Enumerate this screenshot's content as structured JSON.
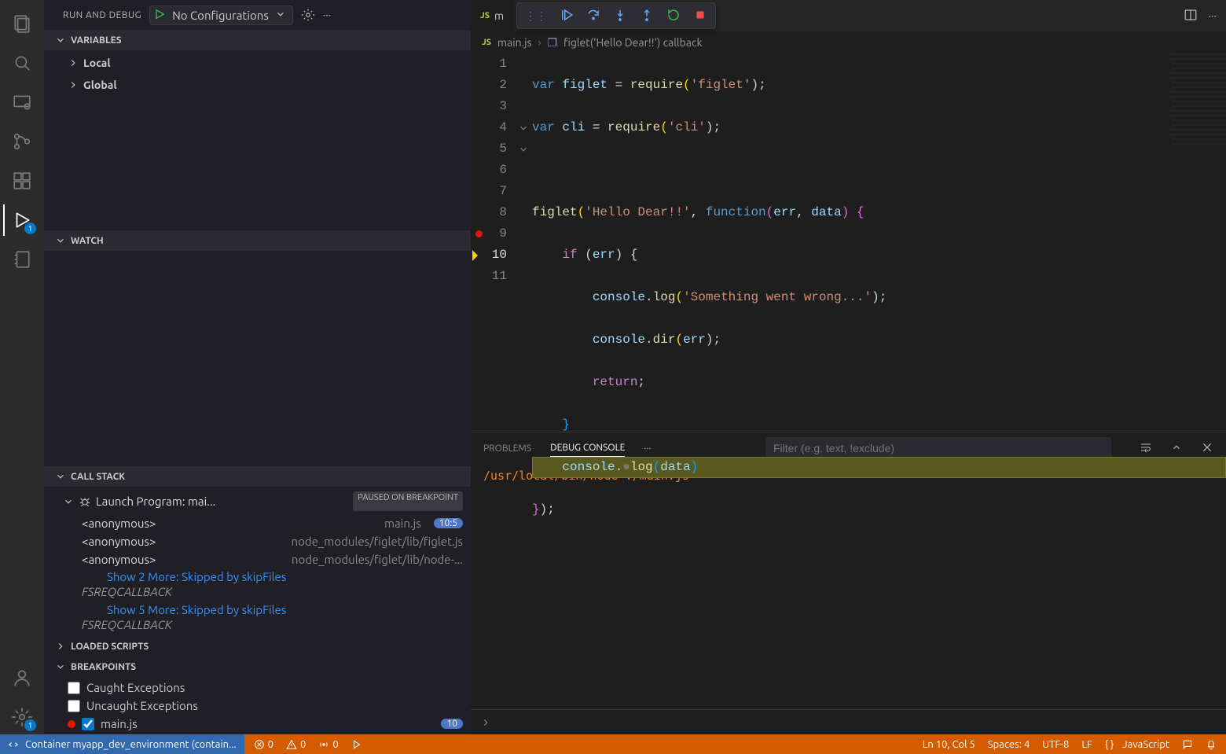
{
  "sidebar": {
    "title": "RUN AND DEBUG",
    "config": "No Configurations",
    "sections": {
      "variables": {
        "label": "VARIABLES",
        "scopes": [
          "Local",
          "Global"
        ]
      },
      "watch": {
        "label": "WATCH"
      },
      "callstack": {
        "label": "CALL STACK",
        "thread": "Launch Program: mai...",
        "status": "PAUSED ON BREAKPOINT",
        "frames": [
          {
            "fn": "<anonymous>",
            "src": "main.js",
            "pos": "10:5"
          },
          {
            "fn": "<anonymous>",
            "src": "node_modules/figlet/lib/figlet.js"
          },
          {
            "fn": "<anonymous>",
            "src": "node_modules/figlet/lib/node-..."
          }
        ],
        "skip1": "Show 2 More: Skipped by skipFiles",
        "origin1": "FSREQCALLBACK",
        "skip2": "Show 5 More: Skipped by skipFiles",
        "origin2": "FSREQCALLBACK"
      },
      "loaded": {
        "label": "LOADED SCRIPTS"
      },
      "breakpoints": {
        "label": "BREAKPOINTS",
        "caught": "Caught Exceptions",
        "uncaught": "Uncaught Exceptions",
        "file": "main.js",
        "line": "10"
      }
    }
  },
  "activity": {
    "debug_badge": "1",
    "settings_badge": "1"
  },
  "editor": {
    "tab_name": "m",
    "breadcrumb_file": "main.js",
    "breadcrumb_symbol": "figlet('Hello Dear!!') callback",
    "current_line": 10,
    "lines": [
      "1",
      "2",
      "3",
      "4",
      "5",
      "6",
      "7",
      "8",
      "9",
      "10",
      "11"
    ],
    "code": {
      "l1": {
        "a": "var ",
        "b": "figlet",
        "c": " = ",
        "d": "require",
        "e": "(",
        "f": "'figlet'",
        "g": ");"
      },
      "l2": {
        "a": "var ",
        "b": "cli",
        "c": " = ",
        "d": "require",
        "e": "(",
        "f": "'cli'",
        "g": ");"
      },
      "l3": "",
      "l4": {
        "a": "figlet",
        "b": "(",
        "c": "'Hello Dear!!'",
        "d": ", ",
        "e": "function",
        "f": "(",
        "g": "err",
        "h": ", ",
        "i": "data",
        "j": ") ",
        "k": "{"
      },
      "l5": {
        "a": "    ",
        "b": "if",
        "c": " (",
        "d": "err",
        "e": ") {"
      },
      "l6": {
        "a": "        ",
        "b": "console",
        "c": ".",
        "d": "log",
        "e": "(",
        "f": "'Something went wrong...'",
        "g": ");"
      },
      "l7": {
        "a": "        ",
        "b": "console",
        "c": ".",
        "d": "dir",
        "e": "(",
        "f": "err",
        "g": ");"
      },
      "l8": {
        "a": "        ",
        "b": "return",
        "c": ";"
      },
      "l9": {
        "a": "    ",
        "b": "}"
      },
      "l10": {
        "a": "    ",
        "b": "console",
        "c": ".",
        "dot": "●",
        "d": "log",
        "e": "(",
        "f": "data",
        "g": ")"
      },
      "l11": {
        "a": "}",
        "b": ");"
      }
    }
  },
  "panel": {
    "tabs": {
      "problems": "PROBLEMS",
      "debug": "DEBUG CONSOLE"
    },
    "filter_placeholder": "Filter (e.g. text, !exclude)",
    "output": "/usr/local/bin/node ./main.js"
  },
  "status": {
    "remote": "Container myapp_dev_environment (contain...",
    "errors": "0",
    "warnings": "0",
    "ports": "0",
    "lncol": "Ln 10, Col 5",
    "spaces": "Spaces: 4",
    "encoding": "UTF-8",
    "eol": "LF",
    "lang": "JavaScript"
  }
}
